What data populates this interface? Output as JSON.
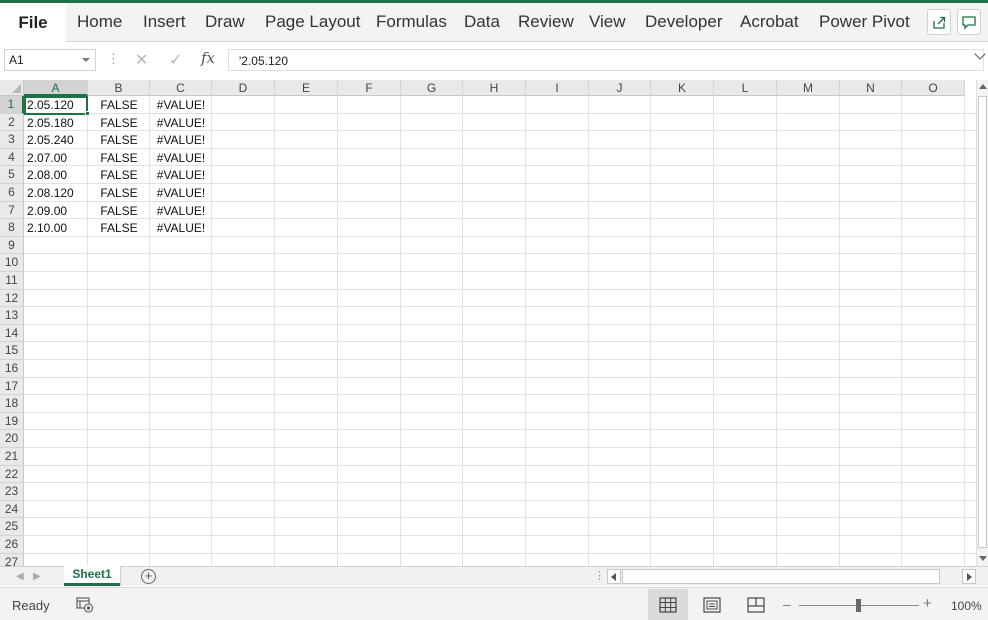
{
  "ribbon": {
    "file_label": "File",
    "tabs": [
      "Home",
      "Insert",
      "Draw",
      "Page Layout",
      "Formulas",
      "Data",
      "Review",
      "View",
      "Developer",
      "Acrobat",
      "Power Pivot"
    ],
    "share_icon": "share-icon",
    "comments_icon": "comment-icon"
  },
  "formula_bar": {
    "name_box": "A1",
    "fx_label": "fx",
    "cancel_icon": "cancel-x-icon",
    "enter_icon": "check-icon",
    "value": "'2.05.120"
  },
  "grid": {
    "column_headers": [
      "A",
      "B",
      "C",
      "D",
      "E",
      "F",
      "G",
      "H",
      "I",
      "J",
      "K",
      "L",
      "M",
      "N",
      "O"
    ],
    "row_headers": [
      "1",
      "2",
      "3",
      "4",
      "5",
      "6",
      "7",
      "8",
      "9",
      "10",
      "11",
      "12",
      "13",
      "14",
      "15",
      "16",
      "17",
      "18",
      "19",
      "20",
      "21",
      "22",
      "23",
      "24",
      "25",
      "26",
      "27"
    ],
    "selected_cell": "A1",
    "rows": [
      [
        "2.05.120",
        "FALSE",
        "#VALUE!"
      ],
      [
        "2.05.180",
        "FALSE",
        "#VALUE!"
      ],
      [
        "2.05.240",
        "FALSE",
        "#VALUE!"
      ],
      [
        "2.07.00",
        "FALSE",
        "#VALUE!"
      ],
      [
        "2.08.00",
        "FALSE",
        "#VALUE!"
      ],
      [
        "2.08.120",
        "FALSE",
        "#VALUE!"
      ],
      [
        "2.09.00",
        "FALSE",
        "#VALUE!"
      ],
      [
        "2.10.00",
        "FALSE",
        "#VALUE!"
      ]
    ]
  },
  "sheet_tabs": {
    "active_sheet": "Sheet1",
    "add_icon": "add-sheet-icon"
  },
  "status_bar": {
    "status": "Ready",
    "zoom": "100%",
    "views": [
      "normal-view-icon",
      "page-layout-view-icon",
      "page-break-preview-icon"
    ],
    "active_view": "normal-view-icon"
  },
  "colors": {
    "accent": "#1e7145",
    "ribbon_bg": "#f3f3f3",
    "grid_line": "#e2e2e2",
    "header_bg": "#e9e9e9"
  }
}
